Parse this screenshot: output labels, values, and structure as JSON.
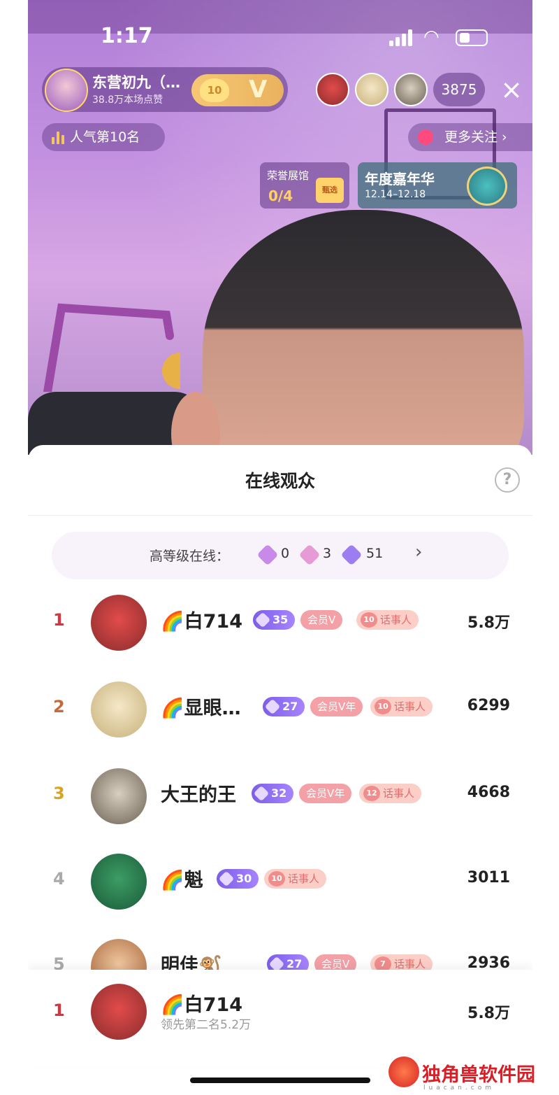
{
  "status_bar": {
    "time": "1:17"
  },
  "host": {
    "name": "东营初九（…",
    "likes": "38.8万本场点赞",
    "heart_level": "10",
    "vip": "V"
  },
  "viewer_count": "3875",
  "close": "×",
  "popularity": "人气第10名",
  "more_follow": "更多关注 ›",
  "honor_hall": {
    "label": "荣誉展馆",
    "value": "0/4",
    "gift": "甄选"
  },
  "carnival": {
    "title": "年度嘉年华",
    "date": "12.14–12.18"
  },
  "sheet": {
    "title": "在线观众",
    "help": "?",
    "level_summary": {
      "label": "高等级在线：",
      "counts": [
        "0",
        "3",
        "51"
      ],
      "chevron": "›"
    }
  },
  "colors": {
    "rank1": "#d9343d",
    "rank2": "#c56a3a",
    "rank3": "#d9a520",
    "rank_other": "#aaaaaa"
  },
  "rows": [
    {
      "rank": "1",
      "name": "🌈白714",
      "level": "35",
      "member": "会员V",
      "talk_level": "10",
      "talk": "话事人",
      "score": "5.8万"
    },
    {
      "rank": "2",
      "name": "🌈显眼…",
      "level": "27",
      "member": "会员V年",
      "talk_level": "10",
      "talk": "话事人",
      "score": "6299"
    },
    {
      "rank": "3",
      "name": "大王的王",
      "level": "32",
      "member": "会员V年",
      "talk_level": "12",
      "talk": "话事人",
      "score": "4668"
    },
    {
      "rank": "4",
      "name": "🌈魁",
      "level": "30",
      "talk_level": "10",
      "talk": "话事人",
      "score": "3011"
    },
    {
      "rank": "5",
      "name": "明佳🐒",
      "level": "27",
      "member": "会员V",
      "talk_level": "7",
      "talk": "话事人",
      "score": "2936"
    }
  ],
  "self_row": {
    "rank": "1",
    "name": "🌈白714",
    "sub": "领先第二名5.2万",
    "score": "5.8万"
  },
  "watermark": {
    "text": "独角兽软件园",
    "sub": "luacan.com"
  }
}
